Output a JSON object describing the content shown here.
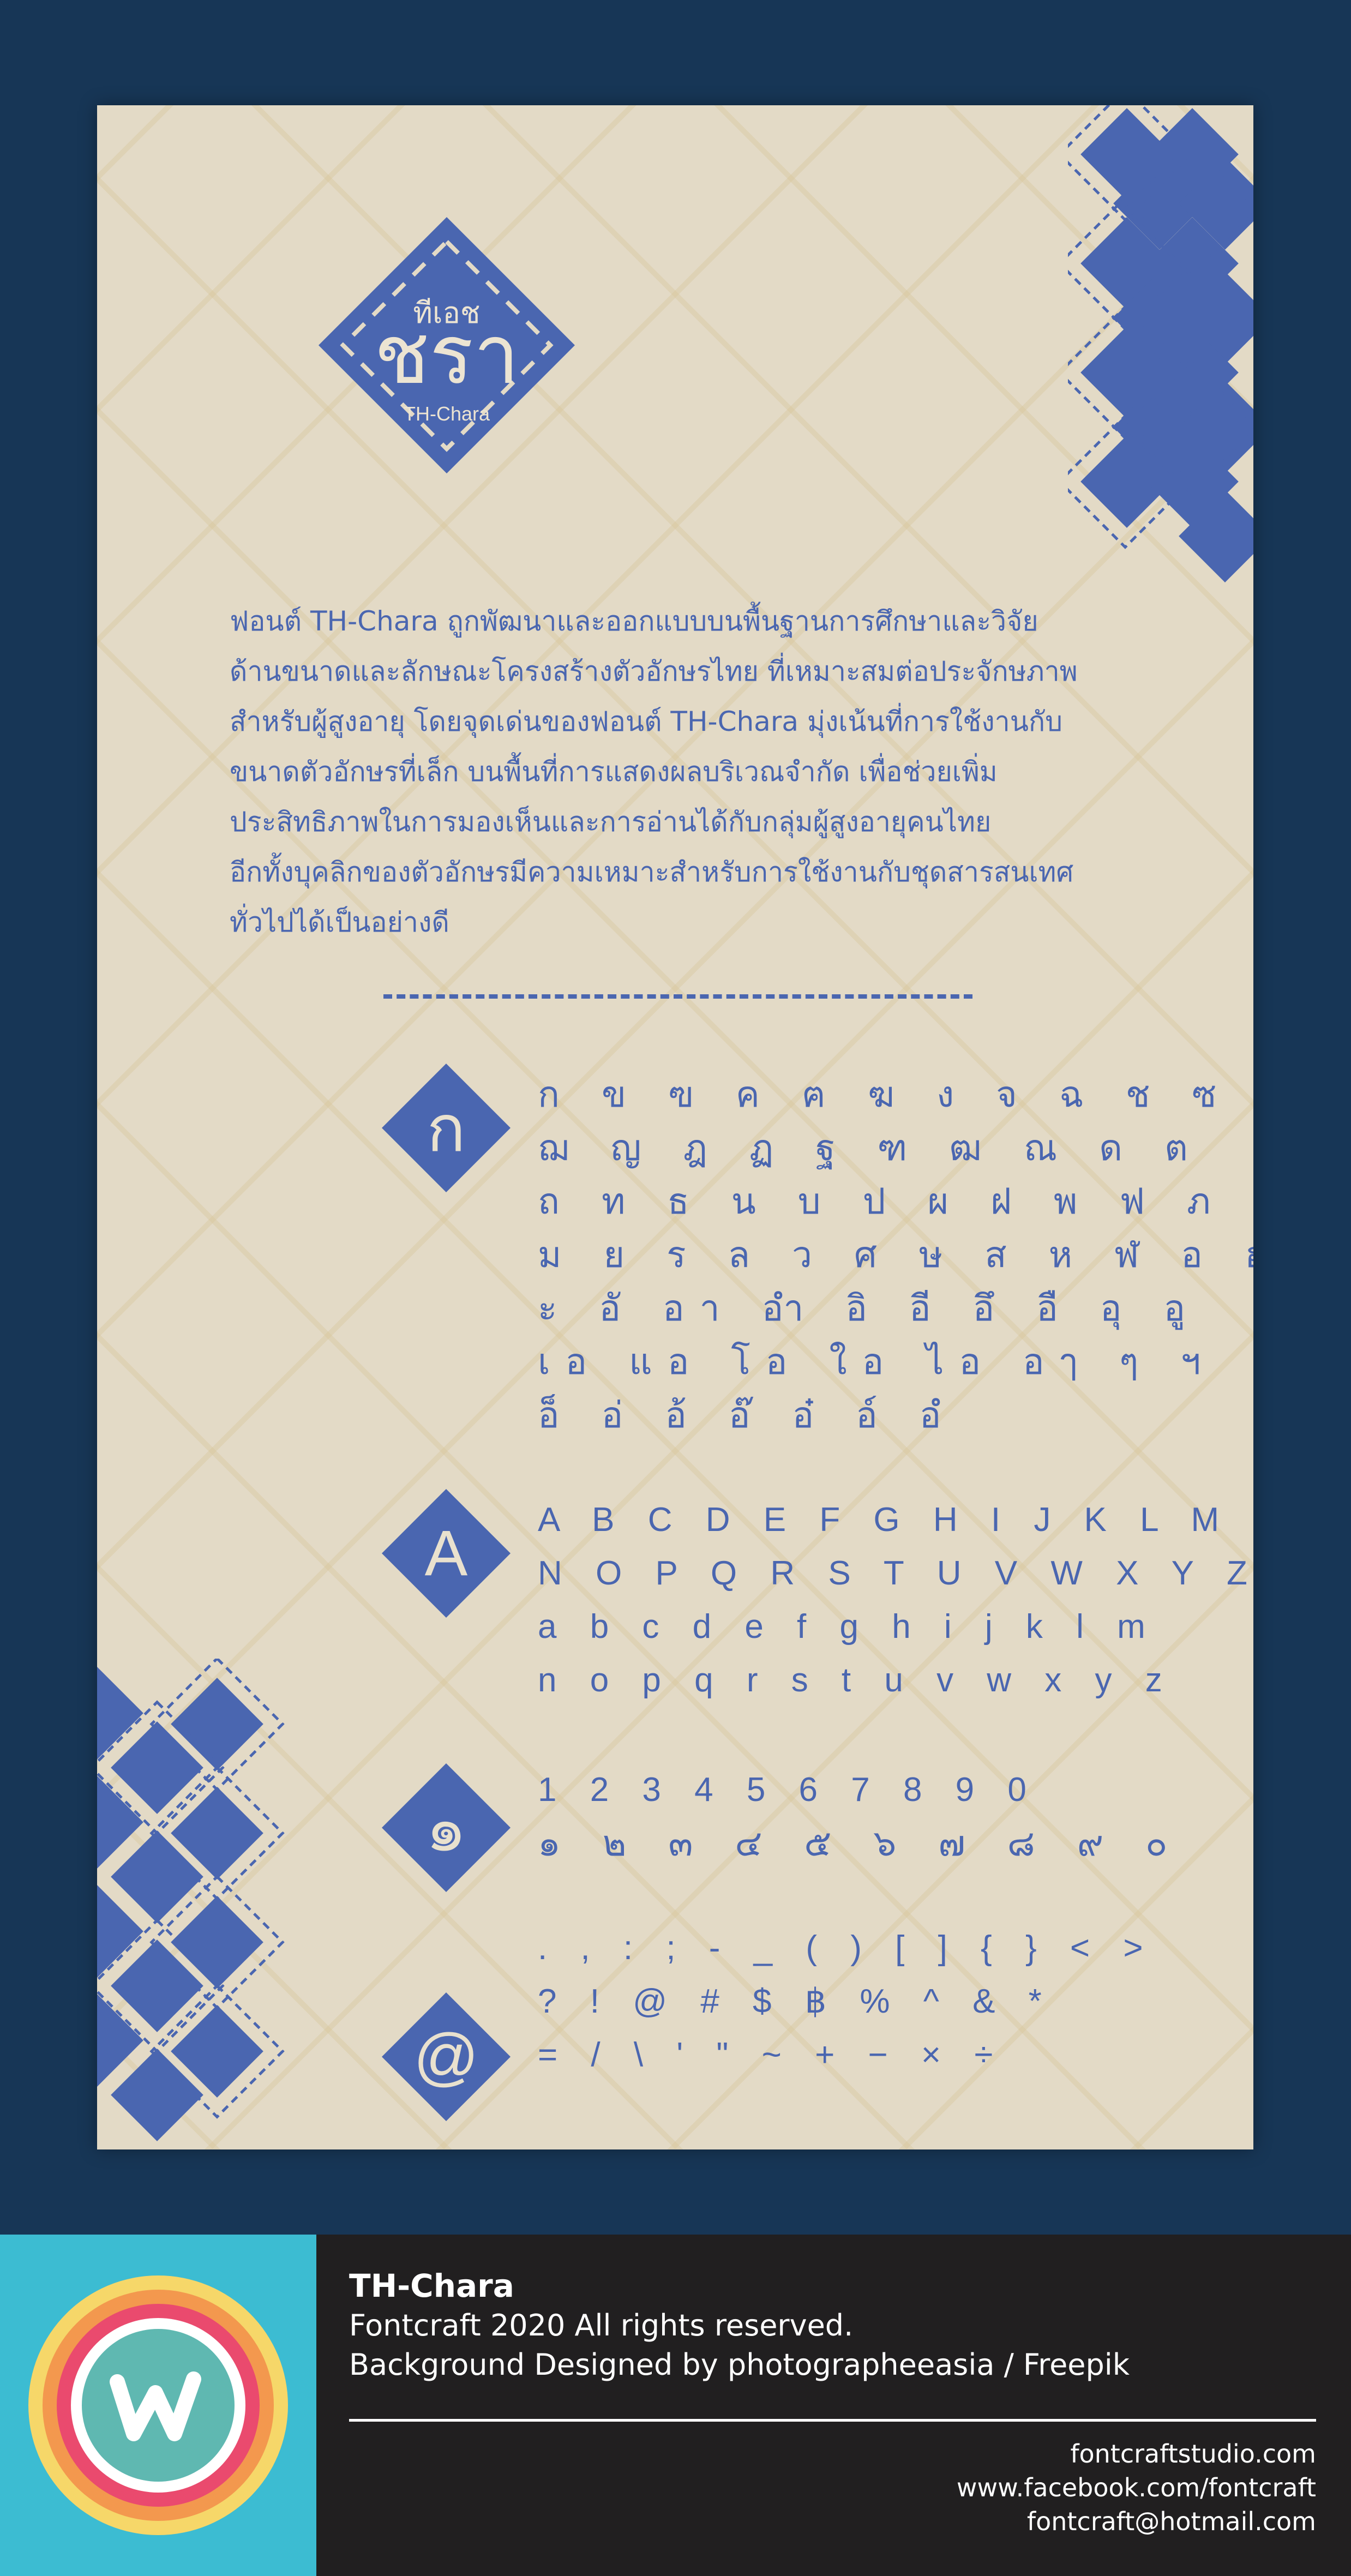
{
  "logo": {
    "thai_small": "ทีเอช",
    "thai_big": "ชรา",
    "latin": "TH-Chara"
  },
  "description": [
    "ฟอนต์ TH-Chara ถูกพัฒนาและออกแบบบนพื้นฐานการศึกษาและวิจัย",
    "ด้านขนาดและลักษณะโครงสร้างตัวอักษรไทย ที่เหมาะสมต่อประจักษภาพ",
    "สำหรับผู้สูงอายุ โดยจุดเด่นของฟอนต์ TH-Chara มุ่งเน้นที่การใช้งานกับ",
    "ขนาดตัวอักษรที่เล็ก บนพื้นที่การแสดงผลบริเวณจำกัด เพื่อช่วยเพิ่ม",
    "ประสิทธิภาพในการมองเห็นและการอ่านได้กับกลุ่มผู้สูงอายุคนไทย",
    "อีกทั้งบุคลิกของตัวอักษรมีความเหมาะสำหรับการใช้งานกับชุดสารสนเทศ",
    "ทั่วไปได้เป็นอย่างดี"
  ],
  "sections": {
    "thai": {
      "badge": "ก",
      "lines": [
        "ก ข ฃ ค ฅ ฆ ง จ ฉ ช ซ",
        "ฌ ญ ฎ ฏ ฐ ฑ ฒ ณ ด ต",
        "ถ ท ธ น บ ป ผ ฝ พ ฟ ภ",
        "ม ย ร ล ว ศ ษ ส ห ฬ อ ฮ",
        "ะ อั อา อำ อิ อี อึ อื อุ อู",
        "เอ แอ โอ ใอ ไอ อๅ ๆ ฯ",
        "อ็ อ่ อ้ อ๊ อ๋ อ์ อํ"
      ]
    },
    "latin": {
      "badge": "A",
      "lines": [
        "A B C D E F G H I J K L M",
        "N O P Q R S T U V W X Y Z",
        "a b c d e f g h i j k l m",
        "n o p q r s t u v w x y z"
      ]
    },
    "numerals": {
      "badge": "๑",
      "lines": [
        "1 2 3 4 5 6 7 8 9 0",
        "๑ ๒ ๓ ๔ ๕ ๖ ๗ ๘ ๙ ๐"
      ]
    },
    "symbols": {
      "badge": "@",
      "lines": [
        ". , : ; - _ ( ) [ ] { } < >",
        "? ! @ # $ ฿ % ^ & *",
        "= / \\ ' \" ~ + − × ÷"
      ]
    }
  },
  "footer": {
    "title": "TH-Chara",
    "line1": "Fontcraft 2020 All rights reserved.",
    "line2": "Background Designed by photographeeasia / Freepik",
    "website": "fontcraftstudio.com",
    "facebook": "www.facebook.com/fontcraft",
    "email": "fontcraft@hotmail.com"
  },
  "colors": {
    "page_background": "#173656",
    "card_background": "#e3dac6",
    "accent_blue": "#4a66b0",
    "footer_background": "#211f20",
    "footer_logo_background": "#3cbcd2"
  }
}
